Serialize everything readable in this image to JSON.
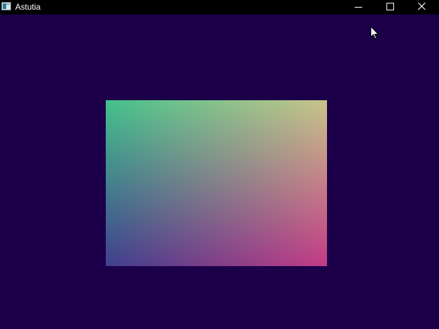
{
  "window": {
    "title": "Astutia",
    "icon": "app-window-icon",
    "background_color": "#1b0049",
    "titlebar_color": "#000000"
  },
  "controls": {
    "minimize_icon": "minimize-icon",
    "maximize_icon": "maximize-icon",
    "close_icon": "close-icon"
  },
  "canvas": {
    "shape": "gradient rectangle",
    "corner_colors": {
      "top_left": "#44c28c",
      "top_right": "#c8c48a",
      "bottom_left": "#3f3f8e",
      "bottom_right": "#c43c86"
    }
  },
  "cursor": "arrow-cursor-icon"
}
